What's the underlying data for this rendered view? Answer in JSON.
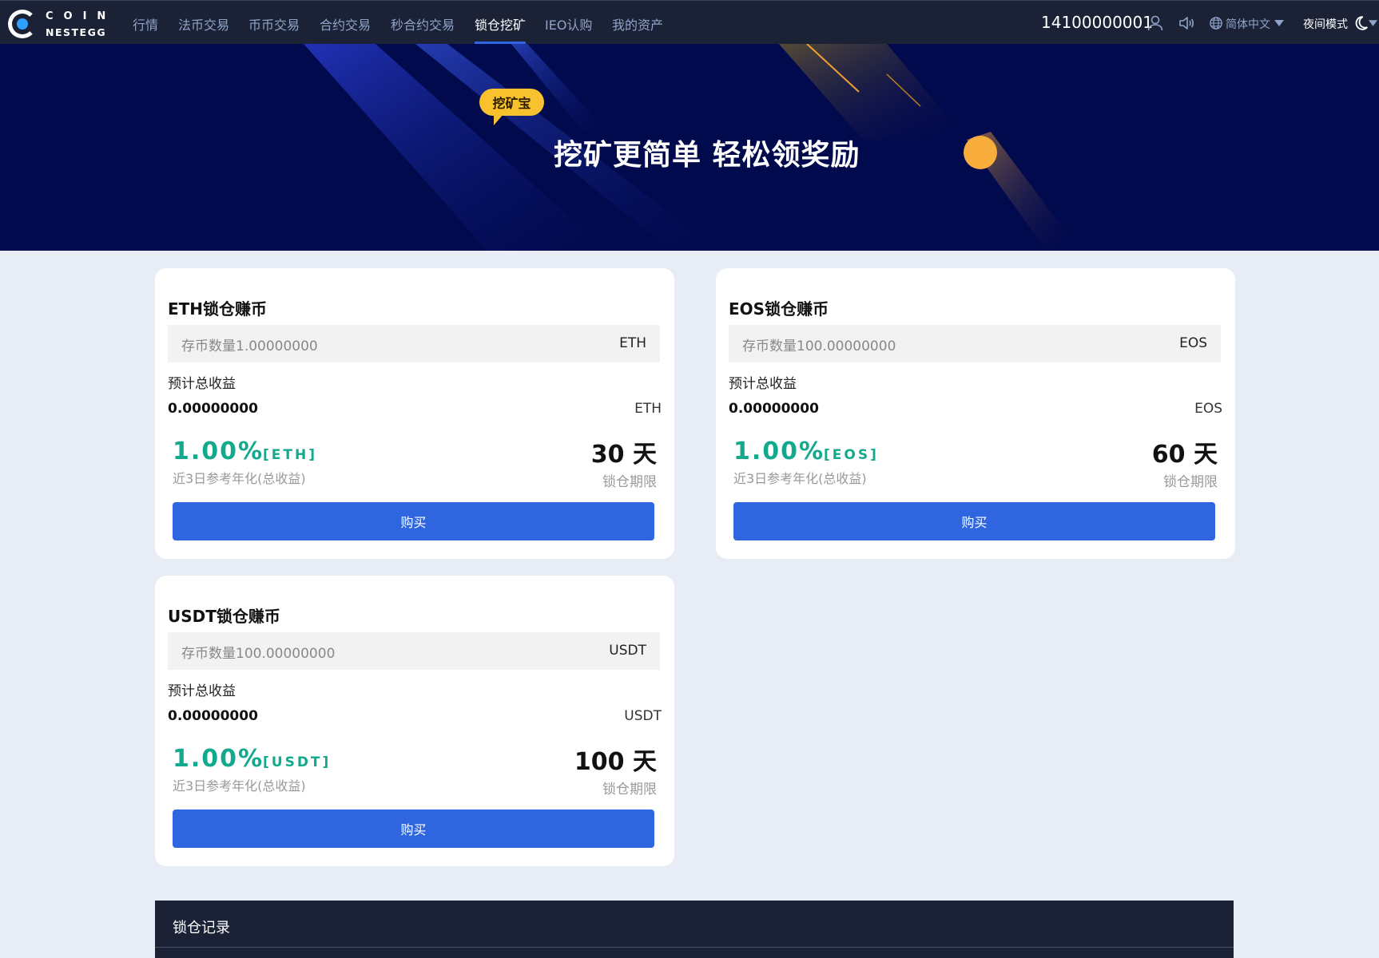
{
  "nav": {
    "logo_top": "COIN",
    "logo_bottom": "NESTEGG",
    "menu": [
      "行情",
      "法币交易",
      "币币交易",
      "合约交易",
      "秒合约交易",
      "锁仓挖矿",
      "IEO认购",
      "我的资产"
    ],
    "active_index": 5,
    "phone": "14100000001",
    "language": "简体中文",
    "night_mode": "夜间模式",
    "icons": [
      "user-icon",
      "speaker-icon",
      "globe-icon",
      "caret-down-icon",
      "moon-icon"
    ]
  },
  "banner": {
    "badge": "挖矿宝",
    "title": "挖矿更简单 轻松领奖励"
  },
  "cards": [
    {
      "title": "ETH锁仓赚币",
      "quantity_placeholder": "存币数量1.00000000",
      "quantity_unit": "ETH",
      "estimate_label": "预计总收益",
      "estimate_value": "0.00000000",
      "estimate_unit": "ETH",
      "rate": "1.00%",
      "rate_coin": "[ETH]",
      "rate_desc": "近3日参考年化(总收益)",
      "term": "30 天",
      "term_label": "锁仓期限",
      "buy": "购买"
    },
    {
      "title": "EOS锁仓赚币",
      "quantity_placeholder": "存币数量100.00000000",
      "quantity_unit": "EOS",
      "estimate_label": "预计总收益",
      "estimate_value": "0.00000000",
      "estimate_unit": "EOS",
      "rate": "1.00%",
      "rate_coin": "[EOS]",
      "rate_desc": "近3日参考年化(总收益)",
      "term": "60 天",
      "term_label": "锁仓期限",
      "buy": "购买"
    },
    {
      "title": "USDT锁仓赚币",
      "quantity_placeholder": "存币数量100.00000000",
      "quantity_unit": "USDT",
      "estimate_label": "预计总收益",
      "estimate_value": "0.00000000",
      "estimate_unit": "USDT",
      "rate": "1.00%",
      "rate_coin": "[USDT]",
      "rate_desc": "近3日参考年化(总收益)",
      "term": "100 天",
      "term_label": "锁仓期限",
      "buy": "购买"
    }
  ],
  "records": {
    "title": "锁仓记录"
  },
  "colors": {
    "nav_bg": "#1b2236",
    "banner_bg": "#020a4e",
    "accent_blue": "#2f66e0",
    "rate_green": "#12a98c",
    "badge_yellow": "#f8c22e",
    "page_bg": "#e8ecf4"
  }
}
